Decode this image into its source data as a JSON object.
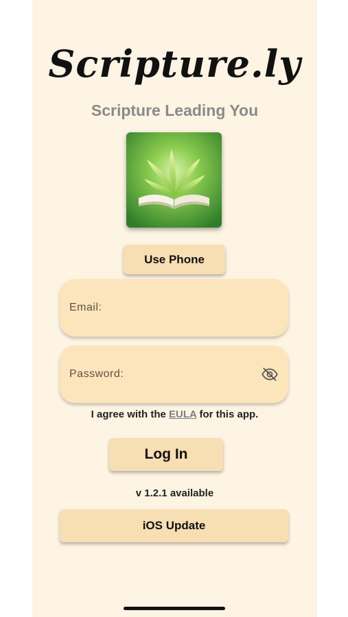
{
  "app": {
    "title": "Scripture.ly",
    "subtitle": "Scripture Leading You",
    "logo_icon": "open-book-with-leaves-icon"
  },
  "buttons": {
    "use_phone": "Use Phone",
    "log_in": "Log In",
    "ios_update": "iOS Update"
  },
  "fields": {
    "email_label": "Email:",
    "password_label": "Password:",
    "password_toggle_icon": "eye-off-icon"
  },
  "agreement": {
    "prefix": "I agree with the ",
    "link": "EULA",
    "suffix": " for this app."
  },
  "version_notice": "v 1.2.1 available",
  "colors": {
    "background": "#fdf4e3",
    "button": "#f7deb3",
    "field": "#fde5bb",
    "subtitle": "#8a8a8a"
  }
}
